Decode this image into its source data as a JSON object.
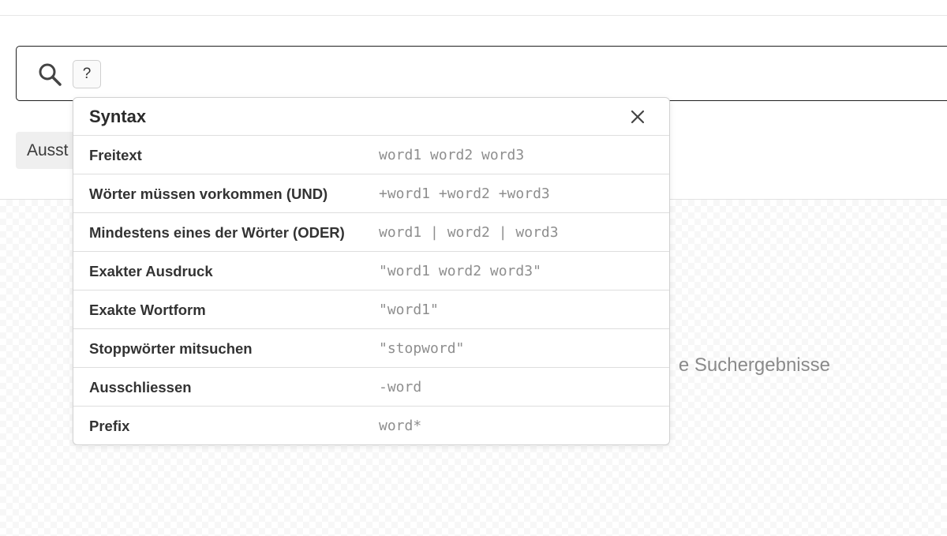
{
  "search": {
    "help_label": "?"
  },
  "filter_chip": {
    "label": "Ausst"
  },
  "results": {
    "empty_message": "e Suchergebnisse"
  },
  "syntax_popover": {
    "title": "Syntax",
    "close_icon": "close-icon",
    "rows": [
      {
        "label": "Freitext",
        "example": "word1 word2 word3"
      },
      {
        "label": "Wörter müssen vorkommen (UND)",
        "example": "+word1 +word2 +word3"
      },
      {
        "label": "Mindestens eines der Wörter (ODER)",
        "example": "word1 | word2 | word3"
      },
      {
        "label": "Exakter Ausdruck",
        "example": "\"word1 word2 word3\""
      },
      {
        "label": "Exakte Wortform",
        "example": "\"word1\""
      },
      {
        "label": "Stoppwörter mitsuchen",
        "example": "\"stopword\""
      },
      {
        "label": "Ausschliessen",
        "example": "-word"
      },
      {
        "label": "Prefix",
        "example": "word*"
      }
    ]
  },
  "colors": {
    "border_dark": "#1f1f1f",
    "muted_text": "#8e8e8e",
    "divider": "#dedede"
  }
}
